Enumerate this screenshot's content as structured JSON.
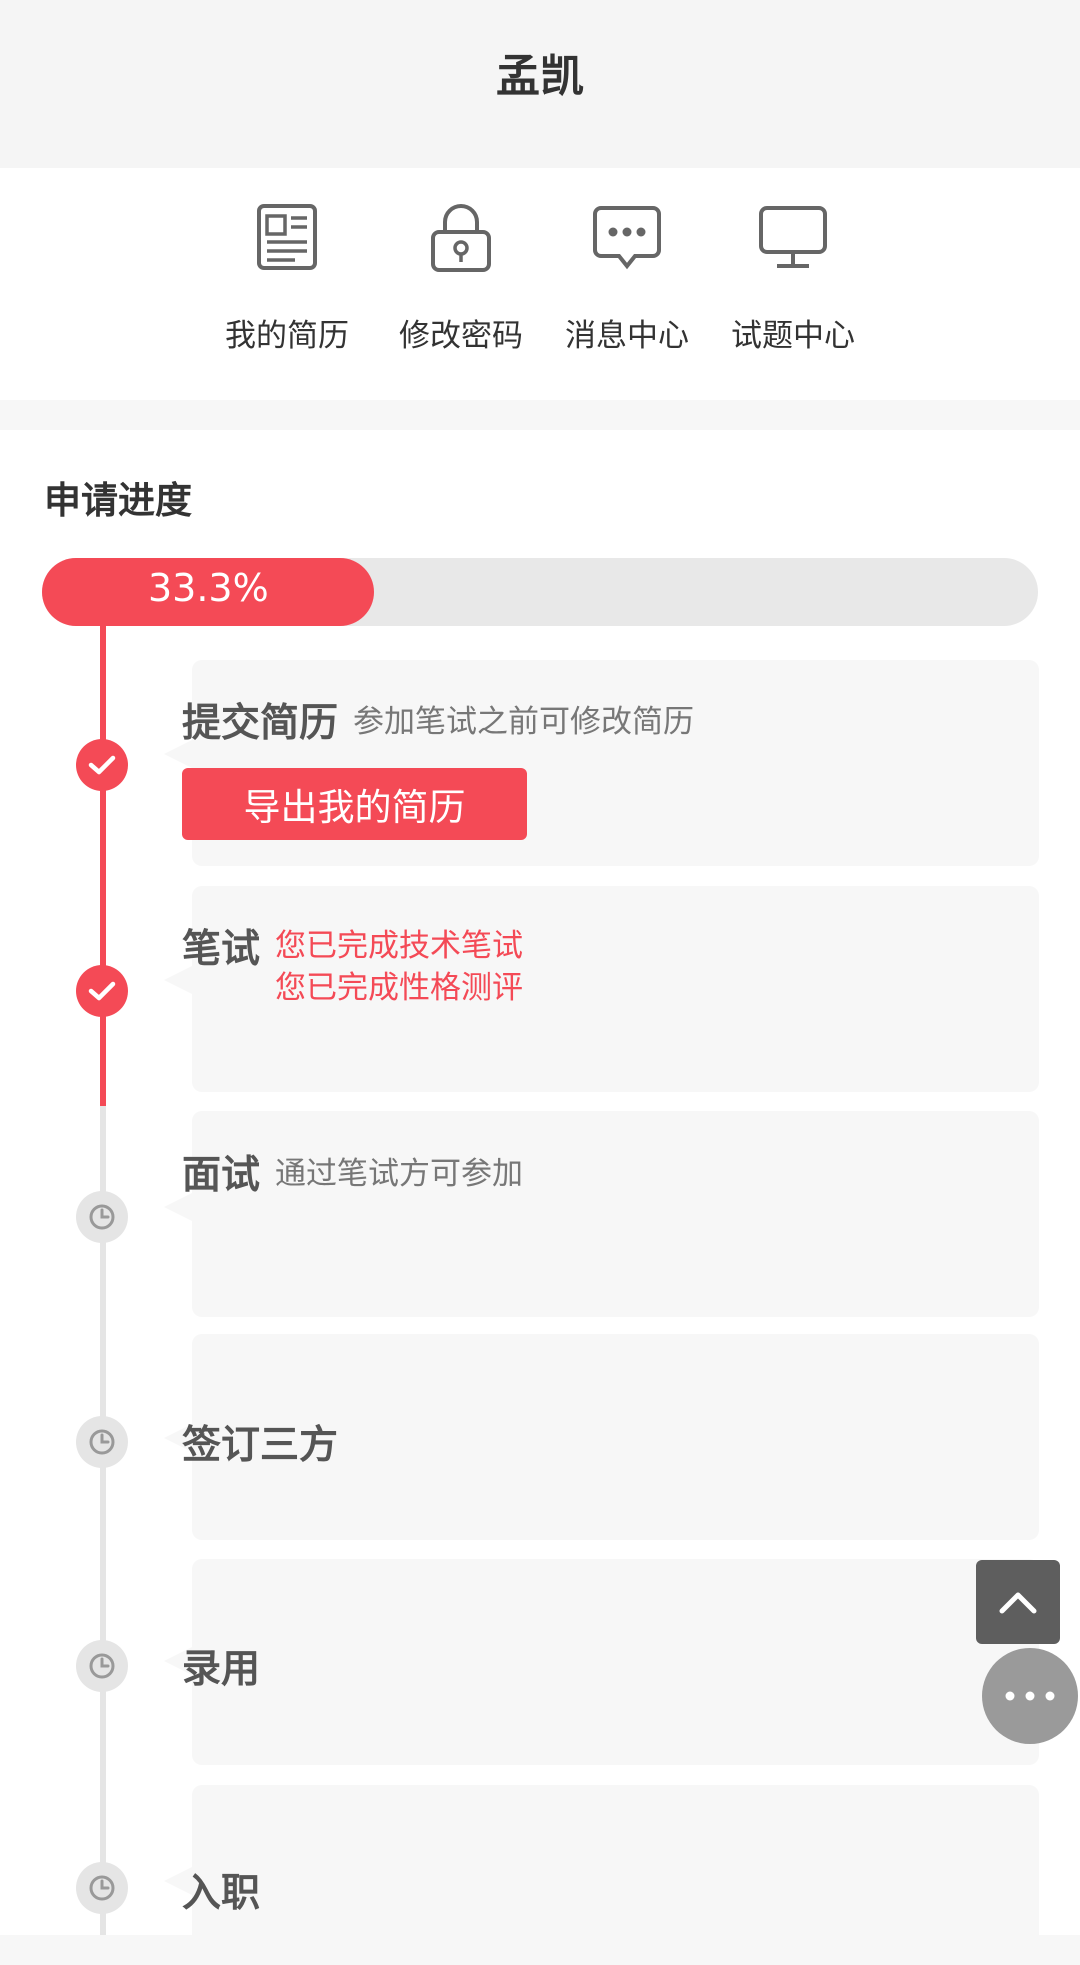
{
  "header": {
    "title": "孟凯"
  },
  "menu": {
    "items": [
      {
        "label": "我的简历",
        "icon": "resume-icon"
      },
      {
        "label": "修改密码",
        "icon": "lock-icon"
      },
      {
        "label": "消息中心",
        "icon": "message-icon"
      },
      {
        "label": "试题中心",
        "icon": "monitor-icon"
      }
    ]
  },
  "progress": {
    "section_title": "申请进度",
    "percent": 33.3,
    "percent_label": "33.3%",
    "accent_color": "#f44a56"
  },
  "steps": [
    {
      "title": "提交简历",
      "status": "done",
      "description": "参加笔试之前可修改简历",
      "button_label": "导出我的简历"
    },
    {
      "title": "笔试",
      "status": "done",
      "notes": [
        "您已完成技术笔试",
        "您已完成性格测评"
      ]
    },
    {
      "title": "面试",
      "status": "pending",
      "description": "通过笔试方可参加"
    },
    {
      "title": "签订三方",
      "status": "pending"
    },
    {
      "title": "录用",
      "status": "pending"
    },
    {
      "title": "入职",
      "status": "pending"
    }
  ],
  "floating": {
    "scroll_top_icon": "chevron-up-icon",
    "more_icon": "more-dots-icon"
  }
}
